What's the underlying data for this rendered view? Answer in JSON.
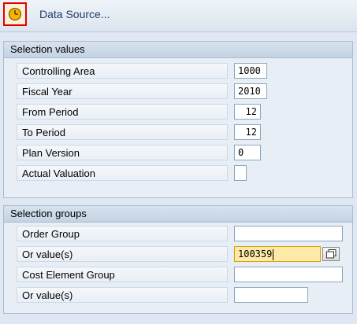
{
  "toolbar": {
    "icon": "execute-clock-icon",
    "data_source_label": "Data Source..."
  },
  "selection_values": {
    "title": "Selection values",
    "rows": [
      {
        "label": "Controlling Area",
        "value": "1000"
      },
      {
        "label": "Fiscal Year",
        "value": "2010"
      },
      {
        "label": "From Period",
        "value": "12"
      },
      {
        "label": "To Period",
        "value": "12"
      },
      {
        "label": "Plan Version",
        "value": "0"
      },
      {
        "label": "Actual Valuation",
        "value": ""
      }
    ]
  },
  "selection_groups": {
    "title": "Selection groups",
    "rows": [
      {
        "label": "Order Group",
        "value": ""
      },
      {
        "label": "Or value(s)",
        "value": "100359"
      },
      {
        "label": "Cost Element Group",
        "value": ""
      },
      {
        "label": "Or value(s)",
        "value": ""
      }
    ]
  },
  "colors": {
    "highlight_border": "#e00000",
    "active_field": "#fde9a8",
    "panel": "#e8eef5"
  }
}
